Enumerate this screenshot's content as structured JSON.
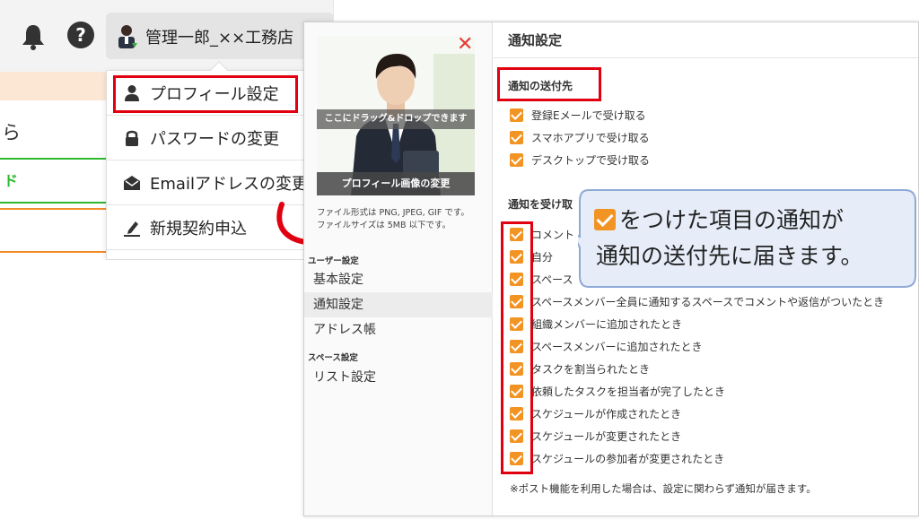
{
  "header": {
    "user_name": "管理一郎_××工務店",
    "help_glyph": "?"
  },
  "dropdown_menu": {
    "items": [
      {
        "label": "プロフィール設定",
        "icon": "person-icon"
      },
      {
        "label": "パスワードの変更",
        "icon": "lock-icon"
      },
      {
        "label": "Emailアドレスの変更",
        "icon": "envelope-icon"
      },
      {
        "label": "新規契約申込",
        "icon": "pen-signature-icon"
      }
    ],
    "highlighted": "プロフィール設定"
  },
  "background_page": {
    "text_fragment": "ら",
    "green_label": "ド"
  },
  "profile_panel": {
    "close_glyph": "✕",
    "drop_hint": "ここにドラッグ&ドロップできます",
    "change_image_button": "プロフィール画像の変更",
    "file_format_note": "ファイル形式は PNG, JPEG, GIF です。",
    "file_size_note": "ファイルサイズは 5MB 以下です。"
  },
  "settings_nav": {
    "user_section": "ユーザー設定",
    "user_items": [
      "基本設定",
      "通知設定",
      "アドレス帳"
    ],
    "active_item": "通知設定",
    "space_section": "スペース設定",
    "space_items": [
      "リスト設定"
    ]
  },
  "notification_settings": {
    "title": "通知設定",
    "delivery_group_title": "通知の送付先",
    "delivery_options": [
      {
        "label": "登録Eメールで受け取る",
        "checked": true
      },
      {
        "label": "スマホアプリで受け取る",
        "checked": true
      },
      {
        "label": "デスクトップで受け取る",
        "checked": true
      }
    ],
    "receive_group_title": "通知を受け取",
    "receive_options": [
      {
        "label": "コメント",
        "checked": true
      },
      {
        "label": "自分",
        "checked": true
      },
      {
        "label": "スペース",
        "checked": true
      },
      {
        "label": "スペースメンバー全員に通知するスペースでコメントや返信がついたとき",
        "checked": true
      },
      {
        "label": "組織メンバーに追加されたとき",
        "checked": true
      },
      {
        "label": "スペースメンバーに追加されたとき",
        "checked": true
      },
      {
        "label": "タスクを割当られたとき",
        "checked": true
      },
      {
        "label": "依頼したタスクを担当者が完了したとき",
        "checked": true
      },
      {
        "label": "スケジュールが作成されたとき",
        "checked": true
      },
      {
        "label": "スケジュールが変更されたとき",
        "checked": true
      },
      {
        "label": "スケジュールの参加者が変更されたとき",
        "checked": true
      }
    ],
    "footnote": "※ポスト機能を利用した場合は、設定に関わらず通知が届きます。"
  },
  "callout": {
    "line1": "をつけた項目の通知が",
    "line2": "通知の送付先に届きます。"
  },
  "colors": {
    "checkbox": "#f29423",
    "highlight_red": "#e0000f",
    "callout_fill": "#e6edf8",
    "callout_border": "#8fa9d6",
    "green": "#2eb82e",
    "orange": "#f28c28"
  }
}
